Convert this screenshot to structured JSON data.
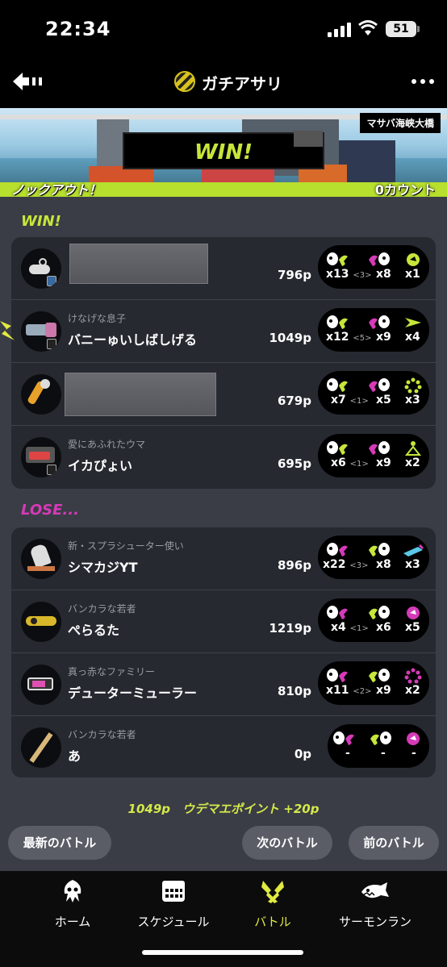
{
  "status_bar": {
    "time": "22:34",
    "battery": "51"
  },
  "nav": {
    "title": "ガチアサリ",
    "back_icon": "back-arrow-icon",
    "more_icon": "more-dots-icon",
    "mode_icon": "clam-blitz-icon"
  },
  "banner": {
    "stage": "マサバ海峡大橋",
    "result": "WIN!",
    "left_score": "ノックアウト！",
    "right_score": "0カウント"
  },
  "teams": {
    "win_label": "WIN!",
    "lose_label": "LOSE...",
    "win_color": "#c6e63a",
    "lose_color": "#d63ab8"
  },
  "players_win": [
    {
      "title": "",
      "name": "",
      "points": "796p",
      "kills": "x13",
      "assists": "<3>",
      "deaths": "x8",
      "specials": "x1",
      "redacted": true
    },
    {
      "title": "けなげな息子",
      "name": "バニーゅいしばしげる",
      "points": "1049p",
      "kills": "x12",
      "assists": "<5>",
      "deaths": "x9",
      "specials": "x4",
      "redacted": false
    },
    {
      "title": "",
      "name": "",
      "points": "679p",
      "kills": "x7",
      "assists": "<1>",
      "deaths": "x5",
      "specials": "x3",
      "redacted": true
    },
    {
      "title": "愛にあふれたウマ",
      "name": "イカぴょい",
      "points": "695p",
      "kills": "x6",
      "assists": "<1>",
      "deaths": "x9",
      "specials": "x2",
      "redacted": false
    }
  ],
  "players_lose": [
    {
      "title": "新・スプラシューター使い",
      "name": "シマカジYT",
      "points": "896p",
      "kills": "x22",
      "assists": "<3>",
      "deaths": "x8",
      "specials": "x3"
    },
    {
      "title": "バンカラな若者",
      "name": "ぺらるた",
      "points": "1219p",
      "kills": "x4",
      "assists": "<1>",
      "deaths": "x6",
      "specials": "x5"
    },
    {
      "title": "真っ赤なファミリー",
      "name": "デューターミューラー",
      "points": "810p",
      "kills": "x11",
      "assists": "<2>",
      "deaths": "x9",
      "specials": "x2"
    },
    {
      "title": "バンカラな若者",
      "name": "あ",
      "points": "0p",
      "kills": "-",
      "assists": "",
      "deaths": "-",
      "specials": "-"
    }
  ],
  "footer": {
    "summary": "1049p　ウデマエポイント +20p"
  },
  "buttons": {
    "latest": "最新のバトル",
    "next": "次のバトル",
    "prev": "前のバトル"
  },
  "tabs": [
    {
      "label": "ホーム",
      "icon": "squid-home-icon"
    },
    {
      "label": "スケジュール",
      "icon": "calendar-icon"
    },
    {
      "label": "バトル",
      "icon": "battle-icon"
    },
    {
      "label": "サーモンラン",
      "icon": "salmon-icon"
    }
  ]
}
